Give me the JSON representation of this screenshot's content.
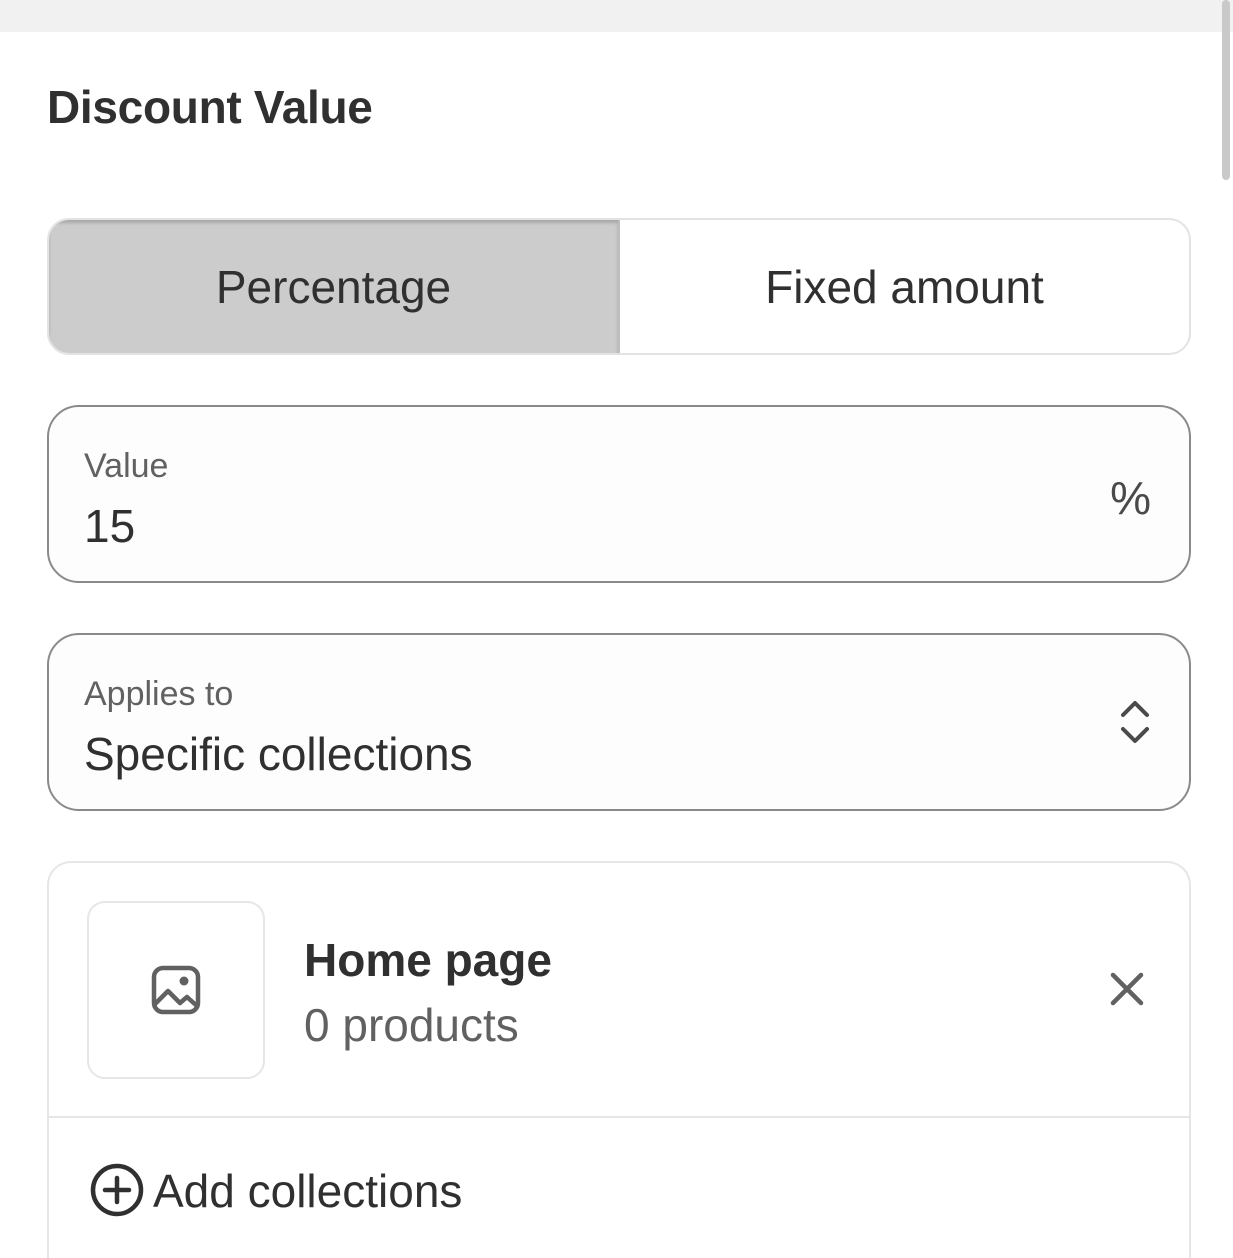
{
  "section": {
    "title": "Discount Value"
  },
  "discount_type": {
    "options": [
      "Percentage",
      "Fixed amount"
    ],
    "selected": "Percentage"
  },
  "value_field": {
    "label": "Value",
    "value": "15",
    "suffix": "%"
  },
  "applies_to": {
    "label": "Applies to",
    "value": "Specific collections"
  },
  "collections": {
    "items": [
      {
        "name": "Home page",
        "count": "0 products"
      }
    ],
    "add_label": "Add collections"
  },
  "icons": {
    "thumbnail": "image-placeholder-icon",
    "remove": "close-icon",
    "select": "chevron-up-down-icon",
    "add": "plus-circle-icon"
  },
  "colors": {
    "active_segment": "#cccccc",
    "text": "#303030",
    "muted_text": "#616161",
    "field_border": "#8a8a8a"
  }
}
